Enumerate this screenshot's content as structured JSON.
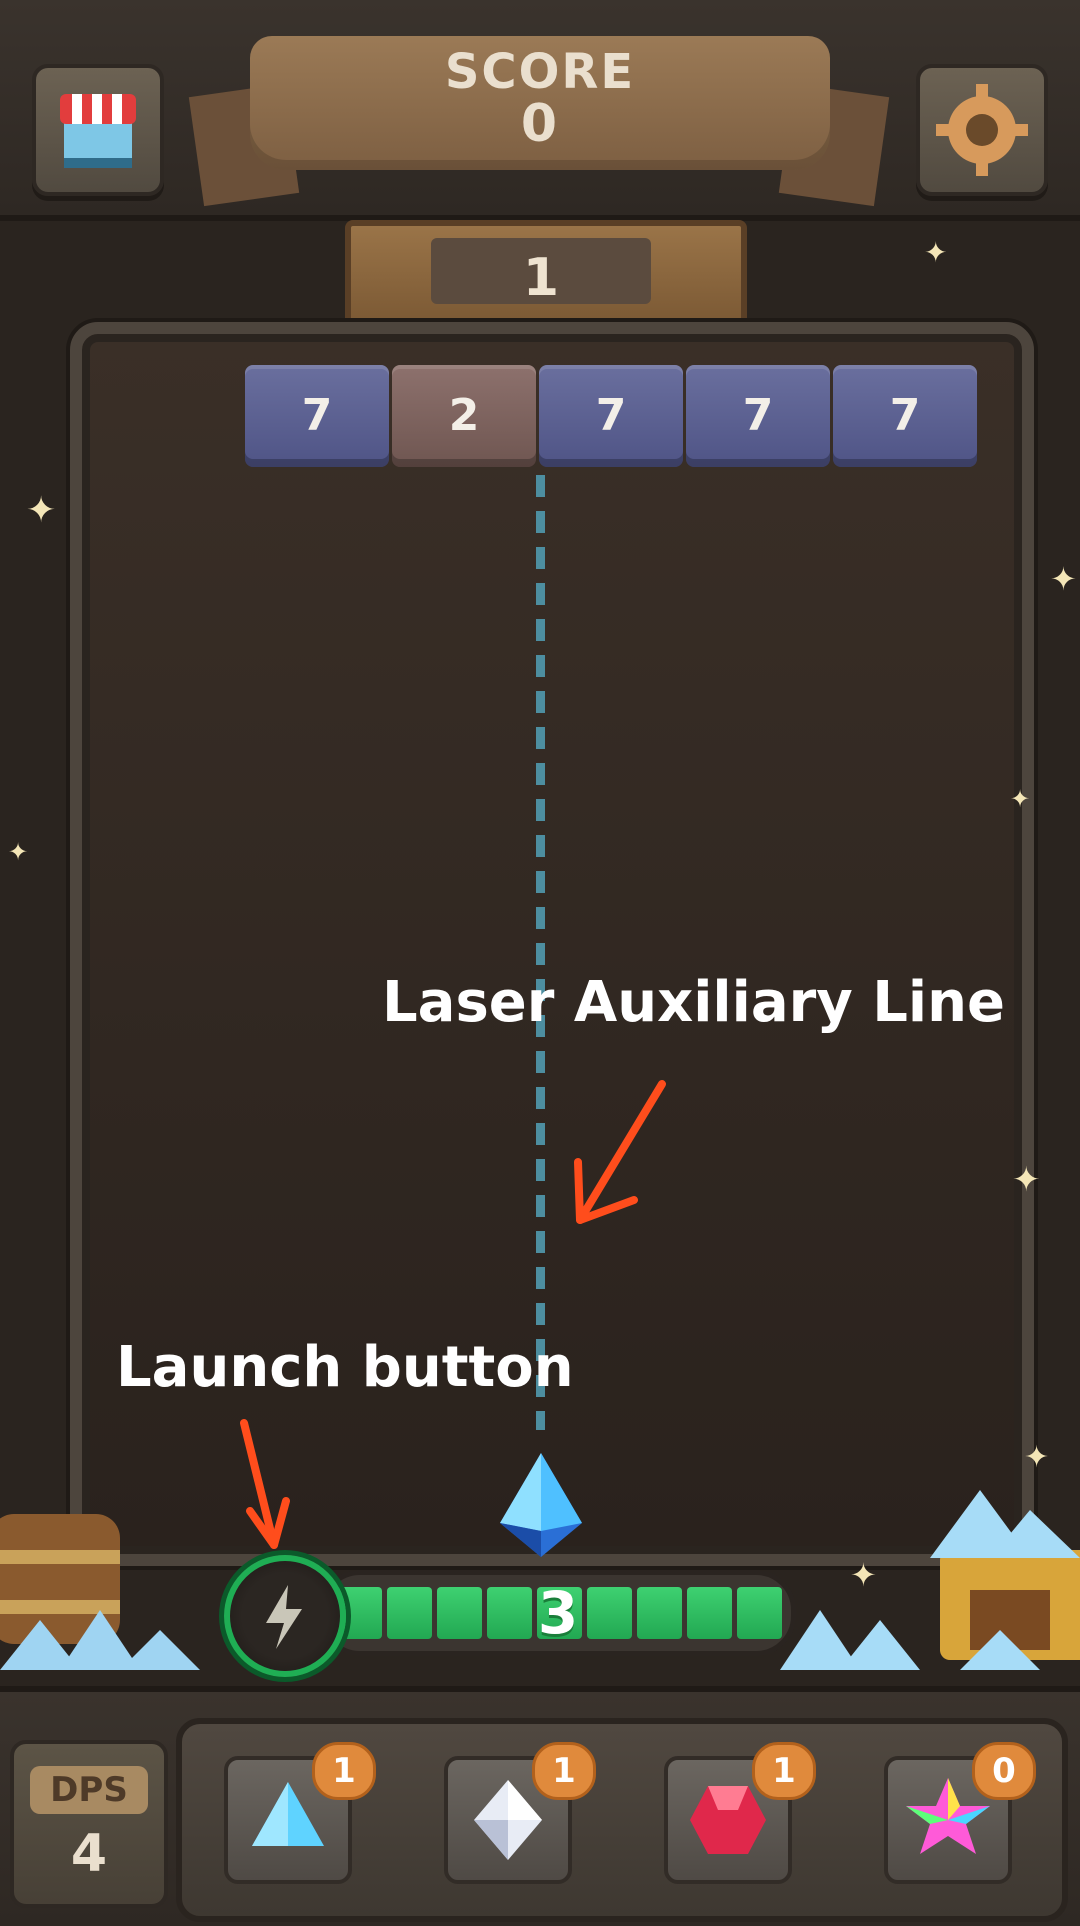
{
  "header": {
    "score_label": "SCORE",
    "score_value": "0",
    "level": "1",
    "shop_icon": "shop-icon",
    "settings_icon": "gear-icon"
  },
  "board": {
    "bricks": [
      {
        "value": "7",
        "color": "blue"
      },
      {
        "value": "2",
        "color": "red"
      },
      {
        "value": "7",
        "color": "blue"
      },
      {
        "value": "7",
        "color": "blue"
      },
      {
        "value": "7",
        "color": "blue"
      }
    ]
  },
  "annotations": {
    "laser": "Laser Auxiliary Line",
    "launch": "Launch button"
  },
  "launcher": {
    "count": "3",
    "icon": "lightning-icon",
    "segments_filled": 9,
    "segments_total": 9
  },
  "footer": {
    "dps_label": "DPS",
    "dps_value": "4",
    "gems": [
      {
        "name": "blue-gem",
        "count": "1"
      },
      {
        "name": "white-gem",
        "count": "1"
      },
      {
        "name": "red-gem",
        "count": "1"
      },
      {
        "name": "rainbow-gem",
        "count": "0"
      }
    ]
  },
  "colors": {
    "accent_green": "#22a852",
    "badge_orange": "#e08a3c",
    "arrow_red": "#ff4d1c"
  }
}
